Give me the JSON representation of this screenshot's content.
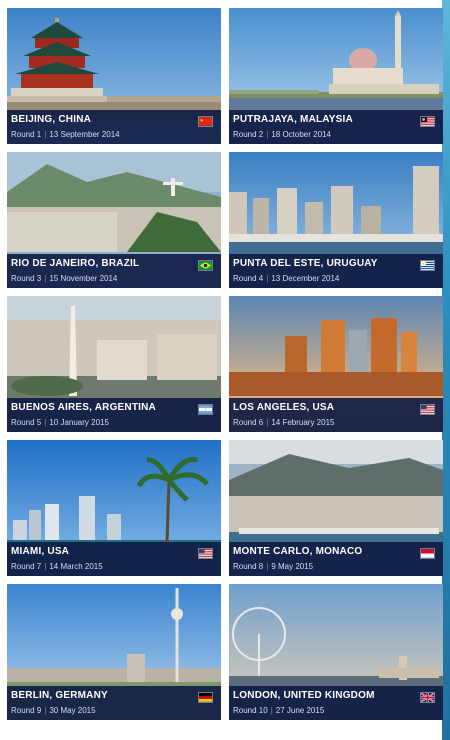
{
  "races": [
    {
      "city": "BEIJING, CHINA",
      "round": "Round 1",
      "date": "13 September 2014",
      "flag": "china-flag-icon"
    },
    {
      "city": "PUTRAJAYA, MALAYSIA",
      "round": "Round 2",
      "date": "18 October 2014",
      "flag": "malaysia-flag-icon"
    },
    {
      "city": "RIO DE JANEIRO, BRAZIL",
      "round": "Round 3",
      "date": "15 November 2014",
      "flag": "brazil-flag-icon"
    },
    {
      "city": "PUNTA DEL ESTE, URUGUAY",
      "round": "Round 4",
      "date": "13 December 2014",
      "flag": "uruguay-flag-icon"
    },
    {
      "city": "BUENOS AIRES, ARGENTINA",
      "round": "Round 5",
      "date": "10 January 2015",
      "flag": "argentina-flag-icon"
    },
    {
      "city": "LOS ANGELES, USA",
      "round": "Round 6",
      "date": "14 February 2015",
      "flag": "usa-flag-icon"
    },
    {
      "city": "MIAMI, USA",
      "round": "Round 7",
      "date": "14 March 2015",
      "flag": "usa-flag-icon"
    },
    {
      "city": "MONTE CARLO, MONACO",
      "round": "Round 8",
      "date": "9 May 2015",
      "flag": "monaco-flag-icon"
    },
    {
      "city": "BERLIN, GERMANY",
      "round": "Round 9",
      "date": "30 May 2015",
      "flag": "germany-flag-icon"
    },
    {
      "city": "LONDON, UNITED KINGDOM",
      "round": "Round 10",
      "date": "27 June 2015",
      "flag": "uk-flag-icon"
    }
  ],
  "colors": {
    "caption_bar": "#101c44",
    "accent_strip": "#2a8fc0"
  }
}
